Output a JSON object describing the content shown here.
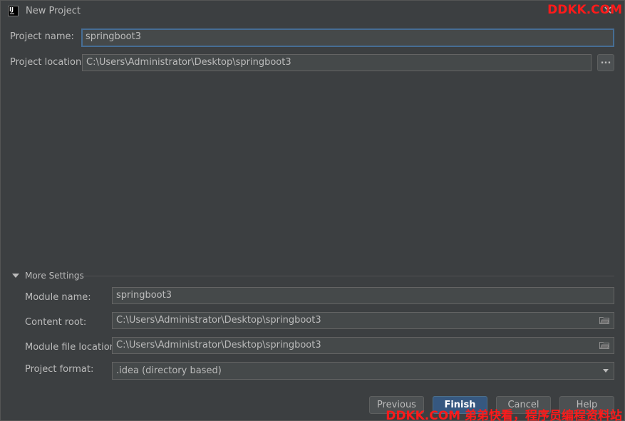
{
  "window": {
    "title": "New Project",
    "app_icon_text": "IJ",
    "close_glyph": "✕",
    "watermark_top": "DDKK.COM"
  },
  "project": {
    "name_label": "Project name:",
    "name_value": "springboot3",
    "location_label": "Project location:",
    "location_value": "C:\\Users\\Administrator\\Desktop\\springboot3",
    "browse_label": "..."
  },
  "more_settings": {
    "title": "More Settings",
    "expanded": true,
    "module_name_label": "Module name:",
    "module_name_value": "springboot3",
    "content_root_label": "Content root:",
    "content_root_value": "C:\\Users\\Administrator\\Desktop\\springboot3",
    "module_file_label": "Module file location:",
    "module_file_value": "C:\\Users\\Administrator\\Desktop\\springboot3",
    "format_label": "Project format:",
    "format_value": ".idea (directory based)"
  },
  "buttons": {
    "previous": "Previous",
    "finish": "Finish",
    "cancel": "Cancel",
    "help": "Help"
  },
  "watermark_bottom": "DDKK.COM 弟弟快看，程序员编程资料站",
  "colors": {
    "background": "#3c3f41",
    "field_background": "#45494a",
    "focus_border": "#466d94",
    "primary_button": "#365880",
    "watermark": "#ff1a1a"
  },
  "icons": {
    "app": "intellij-icon",
    "close": "close-icon",
    "expand": "triangle-down-icon",
    "folder": "folder-icon",
    "dropdown": "chevron-down-icon"
  }
}
